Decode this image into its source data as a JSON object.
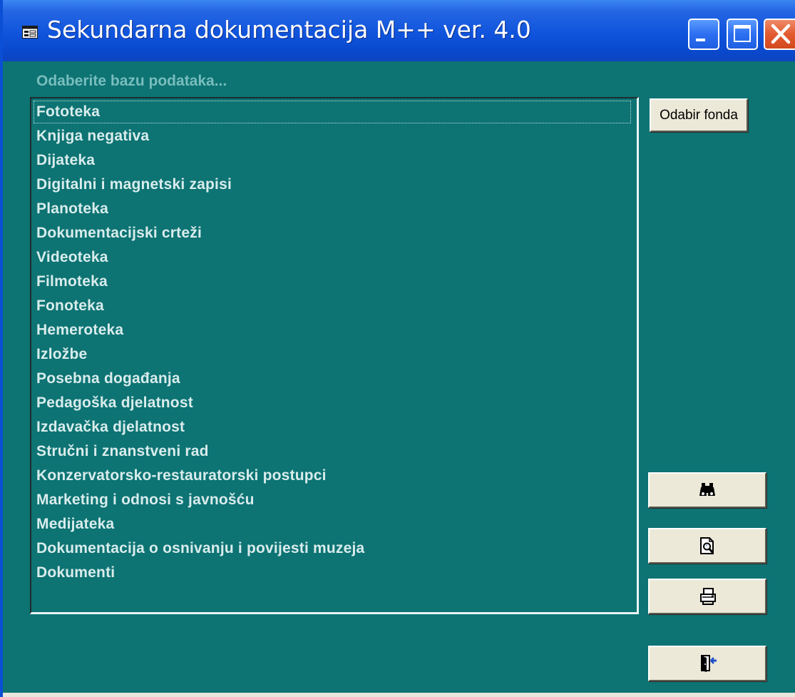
{
  "window": {
    "title": "Sekundarna dokumentacija M++ ver. 4.0",
    "app_icon": "form-icon",
    "controls": {
      "minimize_icon": "minimize-icon",
      "maximize_icon": "maximize-icon",
      "close_icon": "close-icon"
    }
  },
  "prompt": "Odaberite bazu podataka...",
  "database_list": {
    "selected_index": 0,
    "items": [
      "Fototeka",
      "Knjiga negativa",
      "Dijateka",
      "Digitalni i magnetski zapisi",
      "Planoteka",
      "Dokumentacijski crteži",
      "Videoteka",
      "Filmoteka",
      "Fonoteka",
      "Hemeroteka",
      "Izložbe",
      "Posebna događanja",
      "Pedagoška djelatnost",
      "Izdavačka djelatnost",
      "Stručni i znanstveni rad",
      "Konzervatorsko-restauratorski postupci",
      "Marketing i odnosi s javnošću",
      "Medijateka",
      "Dokumentacija o osnivanju i povijesti muzeja",
      "Dokumenti"
    ]
  },
  "buttons": {
    "select_fond_label": "Odabir fonda",
    "search_icon": "binoculars-icon",
    "preview_icon": "print-preview-icon",
    "print_icon": "printer-icon",
    "exit_icon": "exit-door-icon"
  },
  "colors": {
    "form_background": "#0d7373",
    "list_text": "#d9ecec",
    "prompt_text": "#79bdbd",
    "titlebar": "#0f54dc",
    "button_face": "#ece9d8"
  }
}
